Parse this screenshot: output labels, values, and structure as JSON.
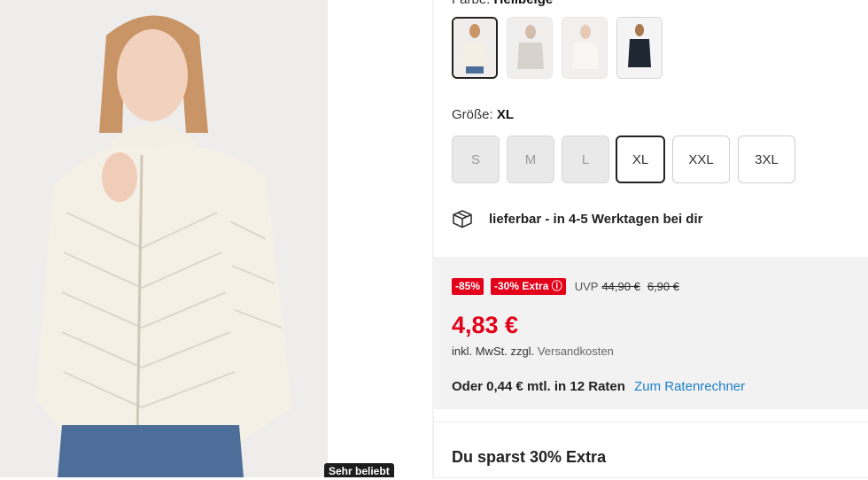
{
  "product": {
    "image_badge": "Sehr beliebt"
  },
  "color": {
    "label": "Farbe:",
    "value": "Hellbeige",
    "swatches": [
      {
        "name": "hellbeige",
        "selected": true
      },
      {
        "name": "grau",
        "selected": false
      },
      {
        "name": "creme",
        "selected": false
      },
      {
        "name": "schwarz",
        "selected": false
      }
    ]
  },
  "size": {
    "label": "Größe:",
    "value": "XL",
    "options": [
      {
        "label": "S",
        "available": false
      },
      {
        "label": "M",
        "available": false
      },
      {
        "label": "L",
        "available": false
      },
      {
        "label": "XL",
        "available": true,
        "selected": true
      },
      {
        "label": "XXL",
        "available": true
      },
      {
        "label": "3XL",
        "available": true
      }
    ]
  },
  "delivery": {
    "icon": "package-icon",
    "text": "lieferbar - in 4-5 Werktagen bei dir"
  },
  "pricing": {
    "discount_tag": "-85%",
    "extra_tag": "-30% Extra ⓘ",
    "uvp_label": "UVP",
    "uvp_price": "44,90 €",
    "old_price": "6,90 €",
    "price": "4,83 €",
    "vat_text": "inkl. MwSt. zzgl.",
    "shipping_link": "Versandkosten",
    "installment_text": "Oder 0,44 € mtl. in 12 Raten",
    "installment_link": "Zum Ratenrechner",
    "accent_color": "#e2001a",
    "link_color": "#1a7fc9"
  },
  "savings": {
    "title": "Du sparst 30% Extra"
  }
}
